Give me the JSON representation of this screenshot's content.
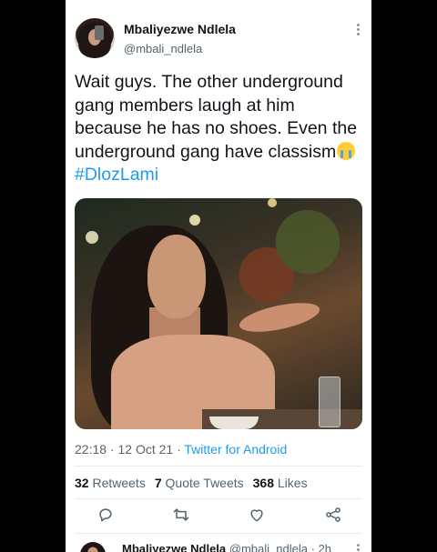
{
  "tweet": {
    "author_name": "Mbaliyezwe Ndlela",
    "author_handle": "@mbali_ndlela",
    "text_main": "Wait guys. The other underground gang members laugh at him because he has no shoes. Even the underground gang have classism",
    "emoji_icon": "crying-face-emoji",
    "hashtag": " #DlozLami",
    "time": "22:18",
    "separator": " · ",
    "date": "12 Oct 21",
    "source": "Twitter for Android",
    "retweets_count": "32",
    "retweets_label": " Retweets",
    "quote_count": "7",
    "quote_label": " Quote Tweets",
    "likes_count": "368",
    "likes_label": " Likes"
  },
  "actions": {
    "reply_icon": "reply-icon",
    "retweet_icon": "retweet-icon",
    "like_icon": "heart-icon",
    "share_icon": "share-icon"
  },
  "next_tweet": {
    "author_name": "Mbaliyezwe Ndlela",
    "handle_time": " @mbali_ndlela · 2h"
  },
  "colors": {
    "accent": "#1d9bf0",
    "text": "#0f1419",
    "secondary": "#536471",
    "background": "#000000"
  }
}
